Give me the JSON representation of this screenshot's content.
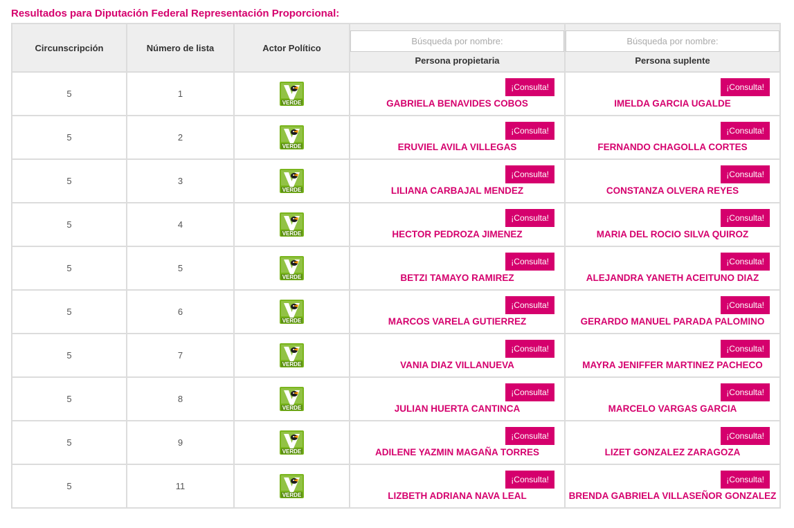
{
  "title": "Resultados para Diputación Federal Representación Proporcional:",
  "headers": {
    "circ": "Circunscripción",
    "num": "Número de lista",
    "actor": "Actor Político",
    "prop": "Persona propietaria",
    "supl": "Persona suplente"
  },
  "search": {
    "prop_placeholder": "Búsqueda por nombre:",
    "supl_placeholder": "Búsqueda por nombre:"
  },
  "consult_label": "¡Consulta!",
  "party": {
    "name": "VERDE",
    "icon": "partido-verde-logo-icon",
    "color": "#7ab51d"
  },
  "colors": {
    "accent": "#d5006d",
    "header_bg": "#eeeeee",
    "border": "#dcdcdc"
  },
  "rows": [
    {
      "circ": "5",
      "num": "1",
      "prop": "GABRIELA BENAVIDES COBOS",
      "supl": "IMELDA GARCIA UGALDE"
    },
    {
      "circ": "5",
      "num": "2",
      "prop": "ERUVIEL AVILA VILLEGAS",
      "supl": "FERNANDO CHAGOLLA CORTES"
    },
    {
      "circ": "5",
      "num": "3",
      "prop": "LILIANA CARBAJAL MENDEZ",
      "supl": "CONSTANZA OLVERA REYES"
    },
    {
      "circ": "5",
      "num": "4",
      "prop": "HECTOR PEDROZA JIMENEZ",
      "supl": "MARIA DEL ROCIO SILVA QUIROZ"
    },
    {
      "circ": "5",
      "num": "5",
      "prop": "BETZI TAMAYO RAMIREZ",
      "supl": "ALEJANDRA YANETH ACEITUNO DIAZ"
    },
    {
      "circ": "5",
      "num": "6",
      "prop": "MARCOS VARELA GUTIERREZ",
      "supl": "GERARDO MANUEL PARADA PALOMINO"
    },
    {
      "circ": "5",
      "num": "7",
      "prop": "VANIA DIAZ VILLANUEVA",
      "supl": "MAYRA JENIFFER MARTINEZ PACHECO"
    },
    {
      "circ": "5",
      "num": "8",
      "prop": "JULIAN HUERTA CANTINCA",
      "supl": "MARCELO VARGAS GARCIA"
    },
    {
      "circ": "5",
      "num": "9",
      "prop": "ADILENE YAZMIN MAGAÑA TORRES",
      "supl": "LIZET GONZALEZ ZARAGOZA"
    },
    {
      "circ": "5",
      "num": "11",
      "prop": "LIZBETH ADRIANA NAVA LEAL",
      "supl": "BRENDA GABRIELA VILLASEÑOR GONZALEZ"
    }
  ]
}
